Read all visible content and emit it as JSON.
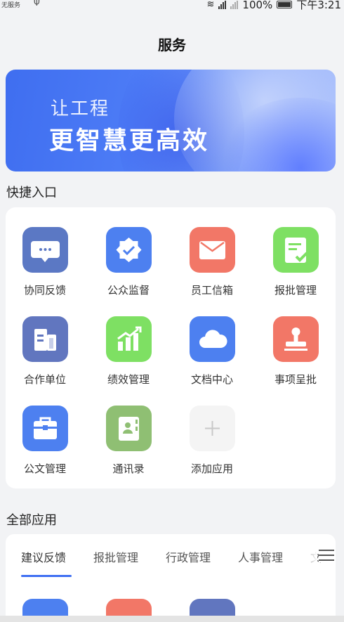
{
  "status": {
    "carrier": "无服务",
    "battery": "100%",
    "time": "下午3:21"
  },
  "page_title": "服务",
  "banner": {
    "line1": "让工程",
    "line2": "更智慧更高效"
  },
  "quick": {
    "title": "快捷入口",
    "items": [
      {
        "label": "协同反馈",
        "icon": "chat-bubble-icon",
        "color": "#5b78c4"
      },
      {
        "label": "公众监督",
        "icon": "shield-badge-icon",
        "color": "#4d80f0"
      },
      {
        "label": "员工信箱",
        "icon": "mail-icon",
        "color": "#f27767"
      },
      {
        "label": "报批管理",
        "icon": "approval-doc-icon",
        "color": "#7ee063"
      },
      {
        "label": "合作单位",
        "icon": "building-icon",
        "color": "#6176bf"
      },
      {
        "label": "绩效管理",
        "icon": "chart-up-icon",
        "color": "#7ee063"
      },
      {
        "label": "文档中心",
        "icon": "cloud-icon",
        "color": "#4d80f0"
      },
      {
        "label": "事项呈批",
        "icon": "stamp-icon",
        "color": "#f27767"
      },
      {
        "label": "公文管理",
        "icon": "briefcase-icon",
        "color": "#4d80f0"
      },
      {
        "label": "通讯录",
        "icon": "contacts-book-icon",
        "color": "#8fbf73"
      },
      {
        "label": "添加应用",
        "icon": "plus-icon",
        "color": "#f3f3f3"
      }
    ]
  },
  "all": {
    "title": "全部应用",
    "tabs": [
      "建议反馈",
      "报批管理",
      "行政管理",
      "人事管理",
      "文"
    ]
  }
}
